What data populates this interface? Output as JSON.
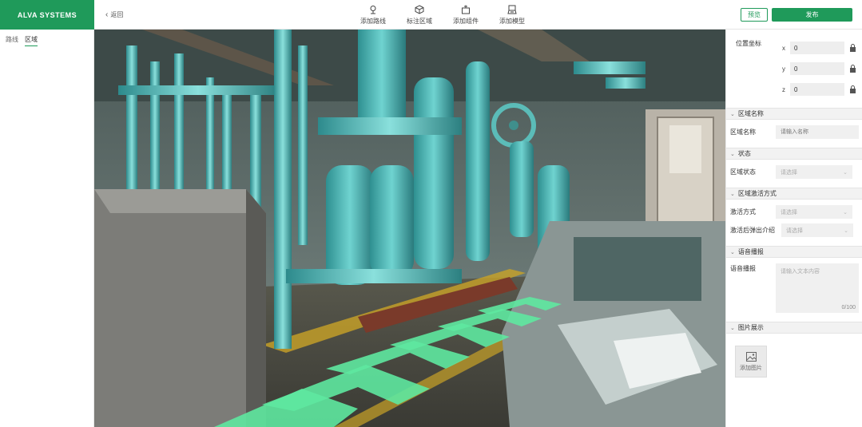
{
  "header": {
    "logo": "ALVA SYSTEMS",
    "back_label": "返回",
    "tools": [
      {
        "icon": "route-pin-icon",
        "label": "添加路线"
      },
      {
        "icon": "area-cube-icon",
        "label": "标注区域"
      },
      {
        "icon": "add-component-icon",
        "label": "添加组件"
      },
      {
        "icon": "add-model-icon",
        "label": "添加模型"
      }
    ],
    "preview_label": "预览",
    "publish_label": "发布"
  },
  "left_panel": {
    "tabs": [
      {
        "label": "路线",
        "active": false
      },
      {
        "label": "区域",
        "active": true
      }
    ]
  },
  "right_panel": {
    "position": {
      "title": "位置坐标",
      "x_label": "x",
      "x_value": "0",
      "y_label": "y",
      "y_value": "0",
      "z_label": "z",
      "z_value": "0"
    },
    "area_name": {
      "section": "区域名称",
      "label": "区域名称",
      "placeholder": "请输入名称"
    },
    "status": {
      "section": "状态",
      "label": "区域状态",
      "placeholder": "请选择"
    },
    "activation": {
      "section": "区域激活方式",
      "mode_label": "激活方式",
      "mode_placeholder": "请选择",
      "popup_label": "激活后弹出介绍",
      "popup_placeholder": "请选择"
    },
    "voice": {
      "section": "语音播报",
      "label": "语音播报",
      "placeholder": "请输入文本内容",
      "count": "0/100"
    },
    "images": {
      "section": "图片展示",
      "add_label": "添加图片"
    }
  },
  "colors": {
    "brand_green": "#1f9a5a",
    "floor_arrow": "#5ee8a0"
  }
}
